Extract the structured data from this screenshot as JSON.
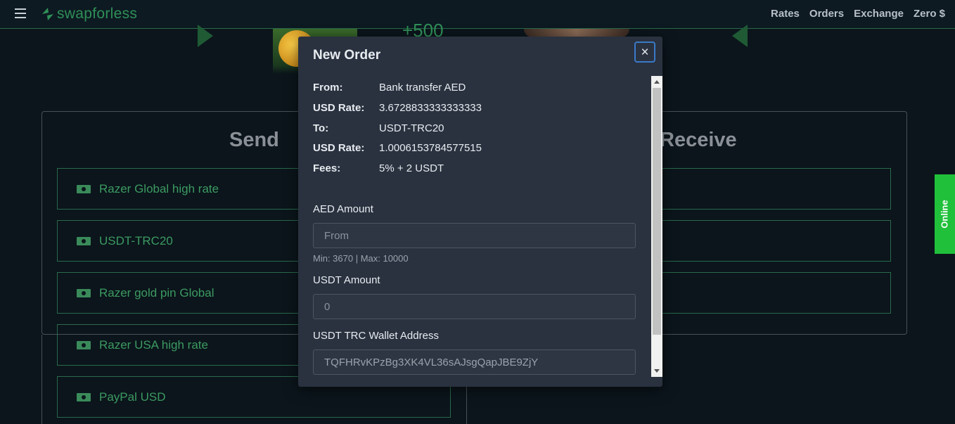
{
  "header": {
    "logo_text": "swapforless",
    "nav": [
      "Rates",
      "Orders",
      "Exchange",
      "Zero $"
    ]
  },
  "banner": {
    "amount_text": "+500"
  },
  "send": {
    "heading": "Send",
    "items": [
      "Razer Global high rate",
      "USDT-TRC20",
      "Razer gold pin Global",
      "Razer USA high rate",
      "PayPal USD"
    ]
  },
  "receive": {
    "heading": "Receive"
  },
  "online_tab": "Online",
  "modal": {
    "title": "New Order",
    "close_icon": "×",
    "info": [
      {
        "key": "From:",
        "value": "Bank transfer AED"
      },
      {
        "key": "USD Rate:",
        "value": "3.6728833333333333"
      },
      {
        "key": "To:",
        "value": "USDT-TRC20"
      },
      {
        "key": "USD Rate:",
        "value": "1.0006153784577515"
      },
      {
        "key": "Fees:",
        "value": "5% + 2 USDT"
      }
    ],
    "aed_amount_label": "AED Amount",
    "aed_amount_placeholder": "From",
    "aed_hint": "Min: 3670 | Max: 10000",
    "usdt_amount_label": "USDT Amount",
    "usdt_amount_value": "0",
    "wallet_label": "USDT TRC Wallet Address",
    "wallet_value": "TQFHRvKPzBg3XK4VL36sAJsgQapJBE9ZjY"
  },
  "colors": {
    "accent_green": "#2f8f57",
    "online_green": "#20c03a",
    "close_border": "#3a7ac8"
  }
}
